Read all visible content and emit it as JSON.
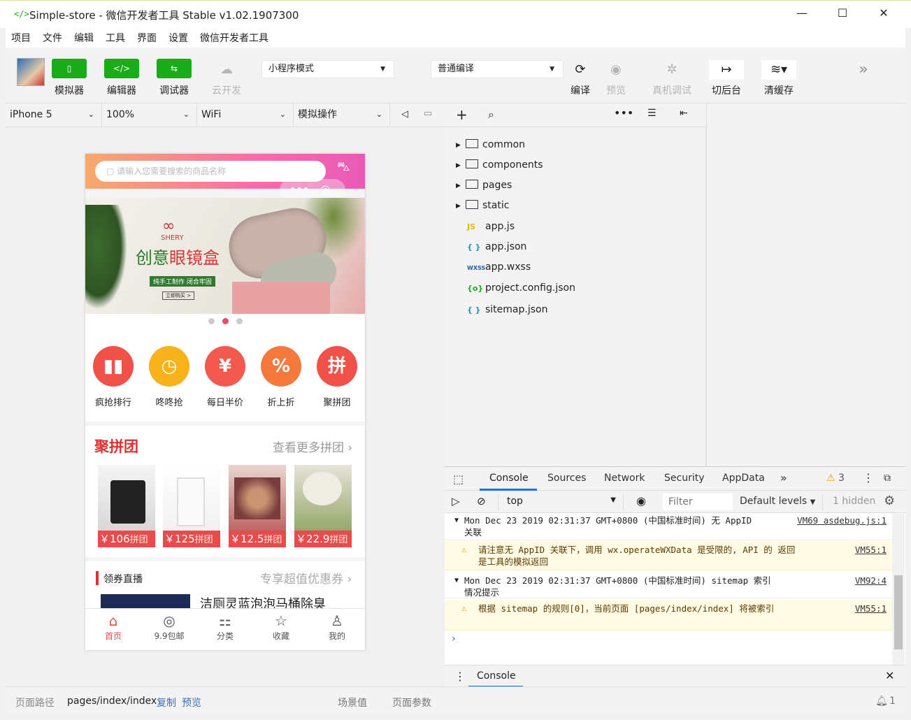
{
  "window": {
    "title": "Simple-store - 微信开发者工具 Stable v1.02.1907300",
    "icon": "</>"
  },
  "menu": [
    "项目",
    "文件",
    "编辑",
    "工具",
    "界面",
    "设置",
    "微信开发者工具"
  ],
  "toolbar": {
    "simulator": "模拟器",
    "editor": "编辑器",
    "debugger": "调试器",
    "cloud": "云开发",
    "mode_select": "小程序模式",
    "compile_select": "普通编译",
    "compile": "编译",
    "preview": "预览",
    "remote_debug": "真机调试",
    "background": "切后台",
    "clear_cache": "清缓存"
  },
  "device_bar": {
    "device": "iPhone 5",
    "zoom": "100%",
    "network": "WiFi",
    "operation": "模拟操作"
  },
  "phone": {
    "search_placeholder": "请输入您需要搜索的商品名称",
    "banner": {
      "brand": "SHERY",
      "title_a": "创意",
      "title_b": "眼镜盒",
      "tag": "纯手工制作 闭合牢固",
      "button": "立即购买 >"
    },
    "categories": [
      {
        "label": "疯抢排行",
        "glyph": "▮▮",
        "color": "#f0524a"
      },
      {
        "label": "咚咚抢",
        "glyph": "◷",
        "color": "#f7b21c"
      },
      {
        "label": "每日半价",
        "glyph": "¥",
        "color": "#f25a4f"
      },
      {
        "label": "折上折",
        "glyph": "%",
        "color": "#f5793d"
      },
      {
        "label": "聚拼团",
        "glyph": "拼",
        "color": "#f0524a"
      }
    ],
    "group_title": "聚拼团",
    "group_more": "查看更多拼团 ›",
    "products": [
      {
        "price": "￥106",
        "tag": "拼团"
      },
      {
        "price": "￥125",
        "tag": "拼团"
      },
      {
        "price": "￥12.5",
        "tag": "拼团"
      },
      {
        "price": "￥22.9",
        "tag": "拼团"
      }
    ],
    "coupon_title": "领券直播",
    "coupon_more": "专享超值优惠券 ›",
    "coupon_item": "洁厕灵蓝泡泡马桶除臭",
    "tabs": [
      {
        "label": "首页",
        "glyph": "⌂"
      },
      {
        "label": "9.9包邮",
        "glyph": "◎"
      },
      {
        "label": "分类",
        "glyph": "⚏"
      },
      {
        "label": "收藏",
        "glyph": "☆"
      },
      {
        "label": "我的",
        "glyph": "♙"
      }
    ]
  },
  "files": {
    "folders": [
      "common",
      "components",
      "pages",
      "static"
    ],
    "items": [
      {
        "name": "app.js",
        "icon": "JS",
        "color": "#e8b21c"
      },
      {
        "name": "app.json",
        "icon": "{ }",
        "color": "#1e8fd6"
      },
      {
        "name": "app.wxss",
        "icon": "WXSS",
        "color": "#1e5fa8"
      },
      {
        "name": "project.config.json",
        "icon": "{o}",
        "color": "#1aad19"
      },
      {
        "name": "sitemap.json",
        "icon": "{ }",
        "color": "#1e8fd6"
      }
    ]
  },
  "devtools": {
    "tabs": [
      "Console",
      "Sources",
      "Network",
      "Security",
      "AppData"
    ],
    "warn_count": "3",
    "context": "top",
    "filter_placeholder": "Filter",
    "levels": "Default levels",
    "hidden": "1 hidden",
    "logs": [
      {
        "text": "Mon Dec 23 2019 02:31:37 GMT+0800 (中国标准时间) 无 AppID 关联",
        "link": "VM69 asdebug.js:1"
      },
      {
        "text": "请注意无 AppID 关联下，调用 wx.operateWXData 是受限的, API 的 返回是工具的模拟返回",
        "link": "VM55:1"
      },
      {
        "text": "Mon Dec 23 2019 02:31:37 GMT+0800 (中国标准时间) sitemap 索引情况提示",
        "link": "VM92:4"
      },
      {
        "text": "根据 sitemap 的规则[0]，当前页面 [pages/index/index] 将被索引",
        "link": "VM55:1"
      }
    ],
    "drawer_tab": "Console"
  },
  "status": {
    "path_label": "页面路径",
    "path": "pages/index/index",
    "copy": "复制",
    "preview": "预览",
    "scene": "场景值",
    "params": "页面参数",
    "notify_count": "1"
  }
}
